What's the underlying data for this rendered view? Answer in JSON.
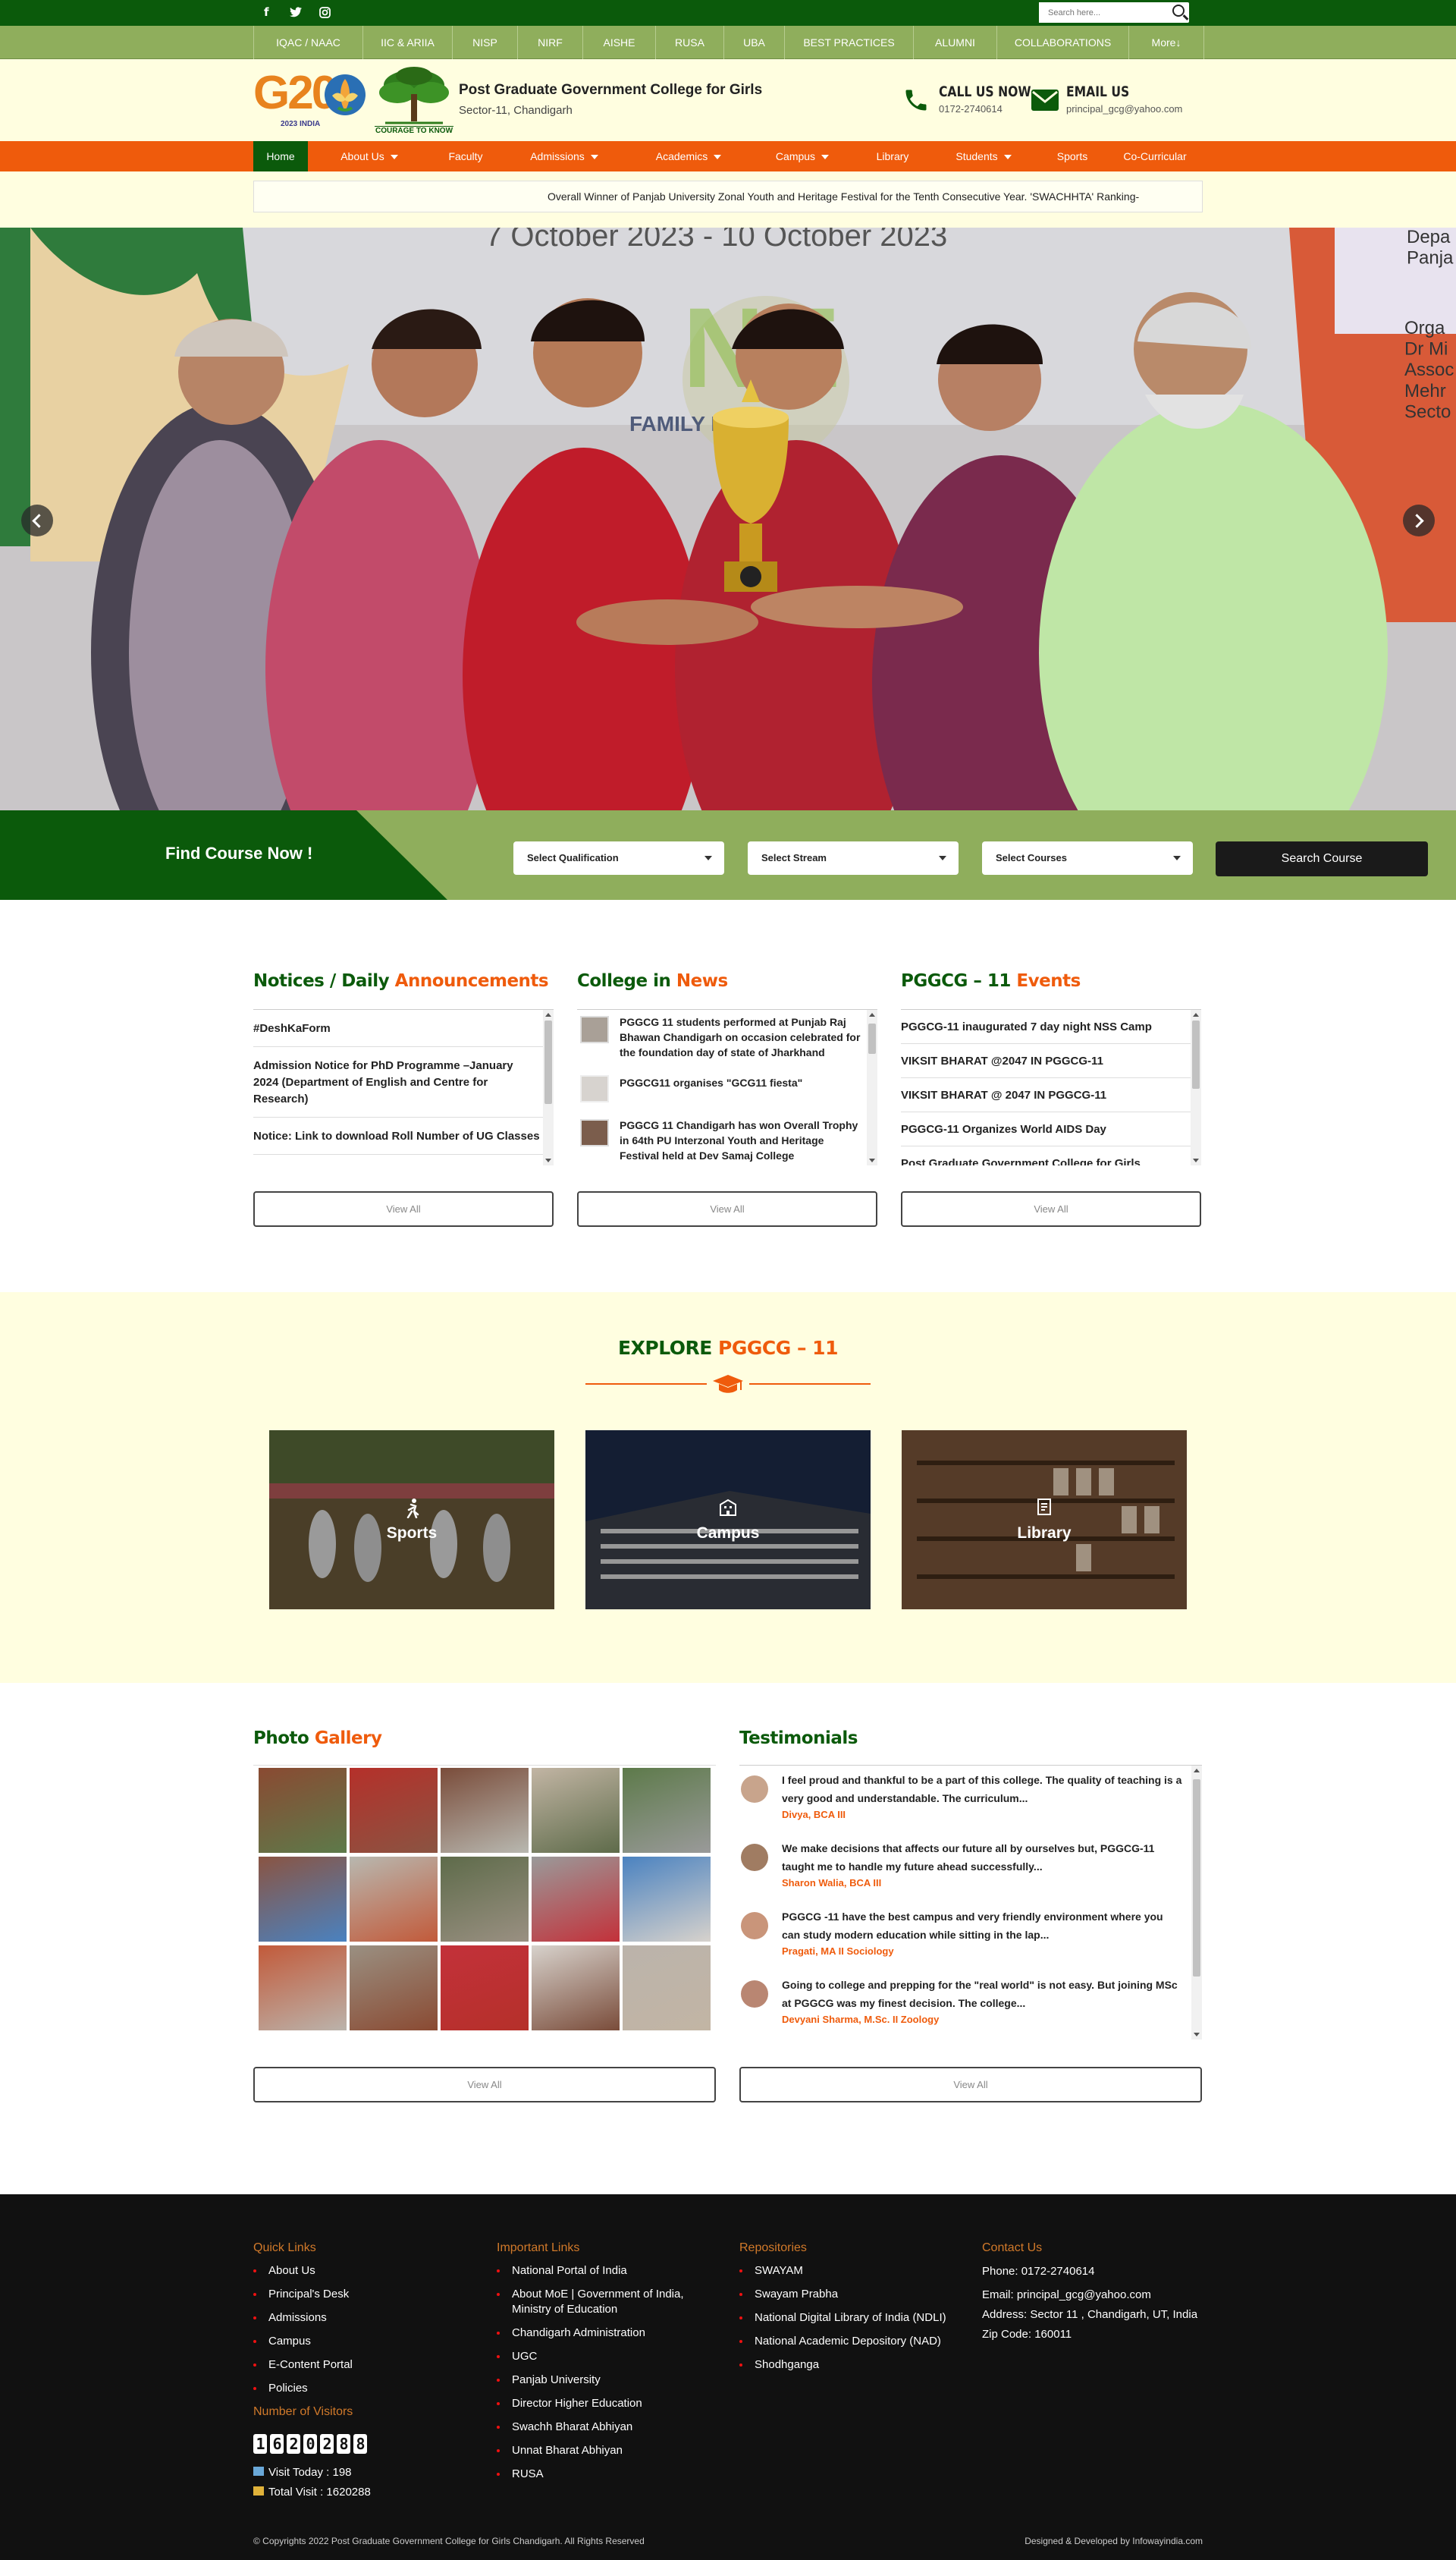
{
  "topbar": {
    "social": [
      "f",
      "t",
      "ig"
    ],
    "search_placeholder": "Search here..."
  },
  "quick_links": [
    "IQAC / NAAC",
    "IIC & ARIIA",
    "NISP",
    "NIRF",
    "AISHE",
    "RUSA",
    "UBA",
    "BEST PRACTICES",
    "ALUMNI",
    "COLLABORATIONS",
    "More↓"
  ],
  "header": {
    "logo_text": "G20",
    "logo_sub": "2023 INDIA",
    "tree_caption": "COURAGE TO KNOW",
    "college_name": "Post Graduate Government College for Girls",
    "college_address": "Sector-11, Chandigarh",
    "call_label": "CALL US NOW",
    "call_value": "0172-2740614",
    "email_label": "EMAIL US",
    "email_value": "principal_gcg@yahoo.com"
  },
  "nav": [
    {
      "label": "Home",
      "active": true,
      "dropdown": false
    },
    {
      "label": "About Us",
      "dropdown": true
    },
    {
      "label": "Faculty",
      "dropdown": false
    },
    {
      "label": "Admissions",
      "dropdown": true
    },
    {
      "label": "Academics",
      "dropdown": true
    },
    {
      "label": "Campus",
      "dropdown": true
    },
    {
      "label": "Library",
      "dropdown": false
    },
    {
      "label": "Students",
      "dropdown": true
    },
    {
      "label": "Sports",
      "dropdown": false
    },
    {
      "label": "Co-Curricular",
      "dropdown": false
    }
  ],
  "ticker": "Overall Winner of Panjab University Zonal Youth and Heritage Festival for the Tenth Consecutive Year.   'SWACHHTA' Ranking-",
  "hero": {
    "banner_text": "7 October 2023 - 10 October 2023",
    "banner_right": "Depa\nPanja",
    "banner_orgs": "Orga\nDr Mi\nAssoc\nMehr\nSecto",
    "banner_family": "FAMILY   FU"
  },
  "finder": {
    "title": "Find Course Now !",
    "qualification": "Select Qualification",
    "stream": "Select Stream",
    "courses": "Select Courses",
    "button": "Search Course"
  },
  "notices": {
    "title_a": "Notices / Daily ",
    "title_b": "Announcements",
    "items": [
      "#DeshKaForm",
      "Admission Notice for PhD Programme –January 2024 (Department of English and Centre for Research)",
      "Notice: Link to download Roll Number of UG Classes"
    ],
    "view_all": "View All"
  },
  "news": {
    "title_a": "College in ",
    "title_b": "News",
    "items": [
      "PGGCG 11 students performed at Punjab Raj Bhawan Chandigarh on occasion celebrated for the foundation day of state of Jharkhand",
      "PGGCG11 organises \"GCG11 fiesta\"",
      "PGGCG 11 Chandigarh has won Overall Trophy in 64th PU Interzonal Youth and Heritage Festival held at Dev Samaj College"
    ],
    "view_all": "View All"
  },
  "events": {
    "title_a": "PGGCG – 11 ",
    "title_b": "Events",
    "items": [
      "PGGCG-11 inaugurated 7 day night NSS Camp",
      "VIKSIT BHARAT @2047 IN PGGCG-11",
      "VIKSIT BHARAT @ 2047 IN PGGCG-11",
      "PGGCG-11 Organizes World AIDS Day",
      "Post Graduate Government College for Girls"
    ],
    "view_all": "View All"
  },
  "explore": {
    "title_a": "EXPLORE ",
    "title_b": "PGGCG – 11",
    "cards": [
      {
        "label": "Sports",
        "icon": "running-icon"
      },
      {
        "label": "Campus",
        "icon": "building-icon"
      },
      {
        "label": "Library",
        "icon": "book-icon"
      }
    ]
  },
  "gallery": {
    "title_a": "Photo ",
    "title_b": "Gallery",
    "view_all": "View All"
  },
  "testimonials": {
    "title": "Testimonials",
    "items": [
      {
        "text": "I feel proud and thankful to be a part of this college. The quality of teaching is a very good and understandable. The curriculum...",
        "name": "Divya, BCA III"
      },
      {
        "text": "We make decisions that affects our future all by ourselves but, PGGCG-11 taught me to handle my future ahead successfully...",
        "name": "Sharon Walia, BCA III"
      },
      {
        "text": "PGGCG -11 have the best campus and very friendly environment where you can study modern education while sitting in the lap...",
        "name": "Pragati, MA II Sociology"
      },
      {
        "text": "Going to college and prepping for the \"real world\" is not easy. But joining MSc at PGGCG was my finest  decision. The college...",
        "name": "Devyani Sharma, M.Sc. II Zoology"
      }
    ],
    "view_all": "View All"
  },
  "footer": {
    "quick_links_title": "Quick Links",
    "quick_links": [
      "About Us",
      "Principal's Desk",
      "Admissions",
      "Campus",
      "E-Content Portal",
      "Policies"
    ],
    "visitors_title": "Number of Visitors",
    "visitor_digits": [
      "1",
      "6",
      "2",
      "0",
      "2",
      "8",
      "8"
    ],
    "visit_today": "Visit Today : 198",
    "total_visit": "Total Visit : 1620288",
    "important_title": "Important Links",
    "important_links": [
      "National Portal of India",
      "About MoE | Government of India, Ministry of Education",
      "Chandigarh Administration",
      "UGC",
      "Panjab University",
      "Director Higher Education",
      "Swachh Bharat Abhiyan",
      "Unnat Bharat Abhiyan",
      "RUSA"
    ],
    "repos_title": "Repositories",
    "repos": [
      "SWAYAM",
      "Swayam Prabha",
      "National Digital Library of India (NDLI)",
      "National Academic Depository (NAD)",
      "Shodhganga"
    ],
    "contact_title": "Contact Us",
    "phone": "Phone:  0172-2740614",
    "email": "Email: principal_gcg@yahoo.com",
    "address": "Address: Sector 11 , Chandigarh, UT, India",
    "zip": "Zip Code:  160011",
    "copyright": "© Copyrights 2022 Post Graduate Government College for Girls Chandigarh. All Rights Reserved",
    "credit": "Designed & Developed by Infowayindia.com"
  },
  "colors": {
    "green": "#0b5a0b",
    "light_green": "#8fae5c",
    "orange": "#ef5b0c",
    "cream": "#fffee0",
    "footer": "#111111"
  }
}
